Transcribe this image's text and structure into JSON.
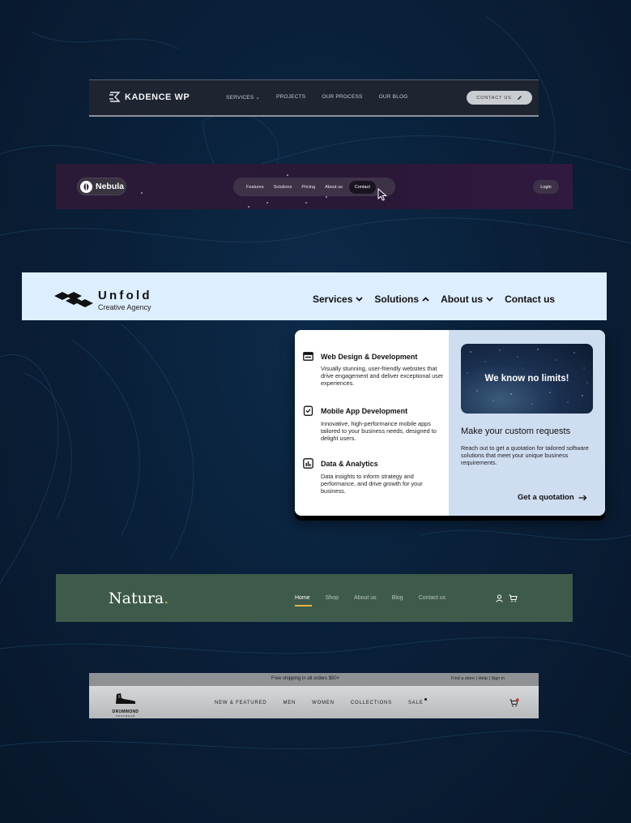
{
  "kadence": {
    "logo": "KADENCE WP",
    "nav": [
      "SERVICES",
      "PROJECTS",
      "OUR PROCESS",
      "OUR BLOG"
    ],
    "cta": "CONTACT US",
    "icons": [
      "kadence-logo-icon",
      "chevron-down-icon",
      "pencil-icon"
    ]
  },
  "nebula": {
    "logo": "Nebula",
    "nav": [
      "Features",
      "Solutions",
      "Pricing",
      "About us",
      "Contact"
    ],
    "active": "Contact",
    "login": "Login",
    "icons": [
      "nebula-leaf-icon",
      "mouse-cursor-icon"
    ]
  },
  "unfold": {
    "brand": "Unfold",
    "tagline": "Creative Agency",
    "nav": [
      "Services",
      "Solutions",
      "About us",
      "Contact us"
    ],
    "services": [
      {
        "title": "Web Design & Development",
        "desc": "Visually stunning, user-friendly websites that drive engagement and deliver exceptional user experiences.",
        "icon": "browser-window-icon"
      },
      {
        "title": "Mobile App Development",
        "desc": "Innovative, high-performance mobile apps tailored to your business needs, designed to delight users.",
        "icon": "clipboard-check-icon"
      },
      {
        "title": "Data & Analytics",
        "desc": "Data insights to inform strategy and performance, and drive growth for your business.",
        "icon": "bar-chart-icon"
      }
    ],
    "promo": {
      "image_text": "We know no limits!",
      "title": "Make your custom requests",
      "desc": "Reach out to get a quotation for tailored software solutions that meet your unique business requirements.",
      "cta": "Get a quotation"
    }
  },
  "natura": {
    "logo": "Natura",
    "logo_dot": ".",
    "nav": [
      "Home",
      "Shop",
      "About us",
      "Blog",
      "Contact us"
    ],
    "active": "Home",
    "accent": "#e6b63e",
    "icons": [
      "user-icon",
      "cart-icon"
    ]
  },
  "drummond": {
    "shipping": "Free shipping in all orders $50+",
    "utility_links": "Find a store  |  Help  |  Sign in",
    "logo": "DRUMMOND",
    "logo_sub": "FOOTWEAR",
    "nav": [
      "NEW & FEATURED",
      "MEN",
      "WOMEN",
      "COLLECTIONS",
      "SALE"
    ],
    "icons": [
      "shoe-logo-icon",
      "cart-icon"
    ]
  }
}
